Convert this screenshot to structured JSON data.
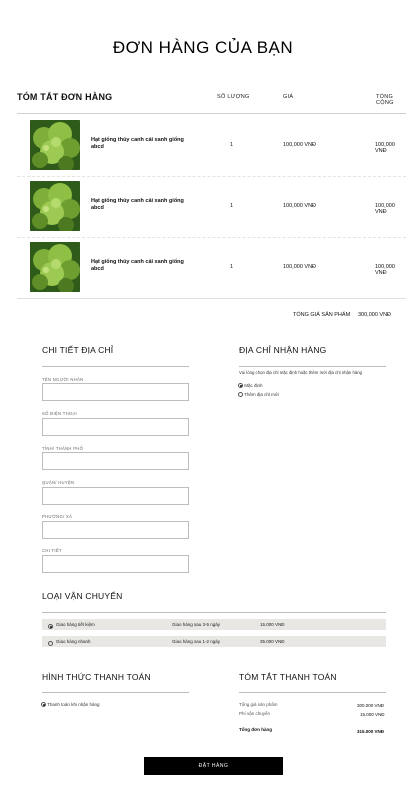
{
  "page": {
    "title": "ĐƠN HÀNG CỦA BẠN"
  },
  "summary": {
    "title": "TÓM TẮT ĐƠN HÀNG",
    "col_qty": "SỐ LƯỢNG",
    "col_price": "GIÁ",
    "col_total": "TỔNG CỘNG",
    "items": [
      {
        "name": "Hạt giống thủy canh cải xanh giống abcd",
        "qty": "1",
        "price": "100,000 VNĐ",
        "total": "100,000 VNĐ",
        "image": "broccoli-image"
      },
      {
        "name": "Hạt giống thủy canh cải xanh giống abcd",
        "qty": "1",
        "price": "100,000 VNĐ",
        "total": "100,000 VNĐ",
        "image": "broccoli-image"
      },
      {
        "name": "Hạt giống thủy canh cải xanh giống abcd",
        "qty": "1",
        "price": "100,000 VNĐ",
        "total": "100,000 VNĐ",
        "image": "broccoli-image"
      }
    ],
    "subtotal_label": "TỔNG GIÁ SẢN PHẨM",
    "subtotal_value": "300,000 VNĐ"
  },
  "address": {
    "title": "CHI TIẾT ĐỊA CHỈ",
    "fields": [
      {
        "label": "TÊN NGƯỜI NHẬN",
        "value": ""
      },
      {
        "label": "SỐ ĐIỆN THOẠI",
        "value": ""
      },
      {
        "label": "TỈNH/ THÀNH PHỐ",
        "value": ""
      },
      {
        "label": "QUẬN/ HUYỆN",
        "value": ""
      },
      {
        "label": "PHƯỜNG/ XÃ",
        "value": ""
      },
      {
        "label": "CHI TIẾT",
        "value": ""
      }
    ]
  },
  "delivery_address": {
    "title": "ĐỊA CHỈ NHẬN HÀNG",
    "hint": "Vui lòng chọn địa chỉ mặc định hoặc thêm mới địa chỉ nhận hàng",
    "options": [
      {
        "label": "Mặc định",
        "selected": true
      },
      {
        "label": "Thêm địa chỉ mới",
        "selected": false
      }
    ]
  },
  "shipping": {
    "title": "LOẠI VẬN CHUYỂN",
    "options": [
      {
        "label": "Giao hàng tiết kiệm",
        "eta": "Giao hàng sau 3-5 ngày",
        "price": "15.000 VNĐ",
        "selected": true
      },
      {
        "label": "Giao hàng nhanh",
        "eta": "Giao hàng sau 1-2 ngày",
        "price": "35.000 VNĐ",
        "selected": false
      }
    ]
  },
  "payment": {
    "title": "HÌNH THỨC THANH TOÁN",
    "options": [
      {
        "label": "Thanh toán khi nhận hàng",
        "selected": true
      }
    ]
  },
  "payment_summary": {
    "title": "TÓM TẮT THANH TOÁN",
    "product_total_label": "Tổng giá sản phẩm",
    "product_total_value": "300.000 VNĐ",
    "shipping_label": "Phí vận chuyển",
    "shipping_value": "15.000 VNĐ",
    "order_total_label": "Tổng đơn hàng",
    "order_total_value": "315.000 VNĐ"
  },
  "actions": {
    "place_order": "ĐẶT HÀNG"
  },
  "colors": {
    "accent": "#000000",
    "shipping_row_bg": "#e9e7e3",
    "divider": "#cfcfcf"
  }
}
